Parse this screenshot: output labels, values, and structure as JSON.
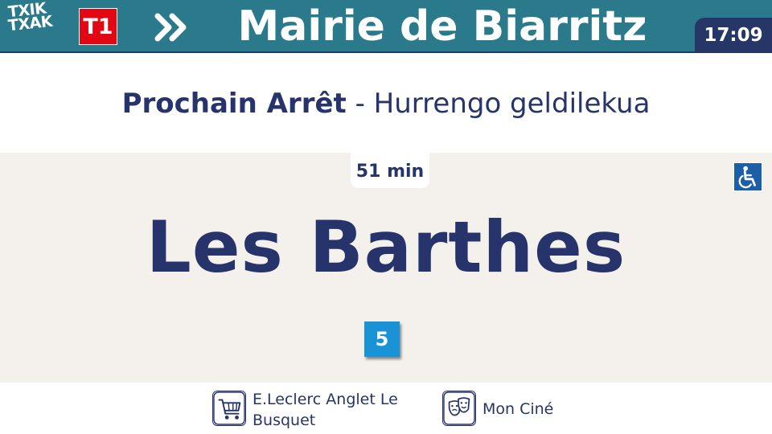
{
  "header": {
    "logo_lines": [
      "TXIK",
      "TXAK"
    ],
    "line": "T1",
    "line_color": "#e30613",
    "bar_color": "#2a7a8c",
    "direction_icon": "double-chevron-right-icon",
    "destination": "Mairie de Biarritz",
    "clock": "17:09"
  },
  "next_stop": {
    "label_fr": "Prochain Arrêt",
    "separator": " - ",
    "label_eu": "Hurrengo geldilekua",
    "eta": "51 min",
    "name": "Les Barthes",
    "accessibility_icon": "wheelchair-icon",
    "connections": [
      {
        "line": "5",
        "color": "#1a93d6"
      }
    ]
  },
  "points_of_interest": [
    {
      "icon": "shopping-cart-icon",
      "label": "E.Leclerc Anglet Le Busquet"
    },
    {
      "icon": "theater-masks-icon",
      "label": "Mon Ciné"
    }
  ]
}
